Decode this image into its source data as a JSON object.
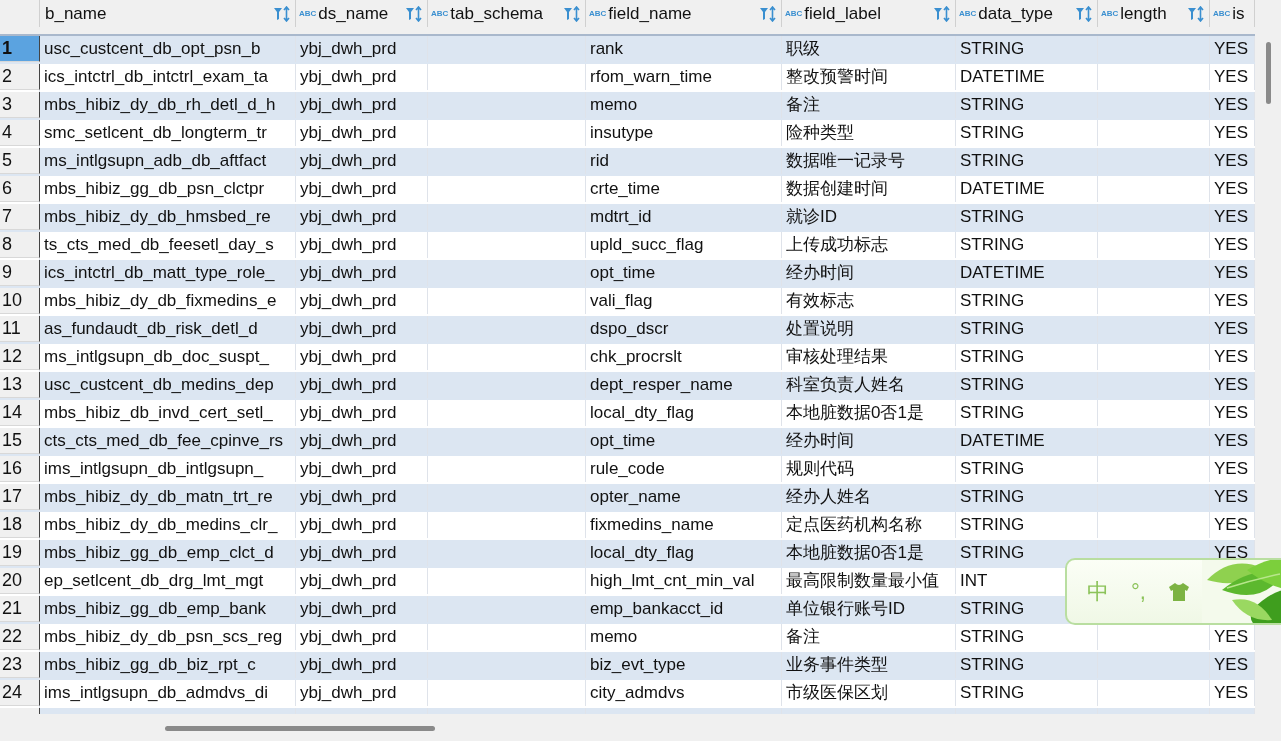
{
  "table": {
    "columns": [
      {
        "label": "b_name",
        "kind": "plain",
        "filter": true
      },
      {
        "label": "ds_name",
        "kind": "string",
        "type_badge": "ABC",
        "filter": true
      },
      {
        "label": "tab_schema",
        "kind": "string",
        "type_badge": "ABC",
        "filter": true
      },
      {
        "label": "field_name",
        "kind": "string",
        "type_badge": "ABC",
        "filter": true
      },
      {
        "label": "field_label",
        "kind": "string",
        "type_badge": "ABC",
        "filter": true
      },
      {
        "label": "data_type",
        "kind": "string",
        "type_badge": "ABC",
        "filter": true
      },
      {
        "label": "length",
        "kind": "string",
        "type_badge": "ABC",
        "filter": true
      },
      {
        "label": "is",
        "kind": "string",
        "type_badge": "ABC",
        "filter": false
      }
    ],
    "rows": [
      {
        "number": "1",
        "selected": true,
        "cells": [
          "usc_custcent_db_opt_psn_b",
          "ybj_dwh_prd",
          "",
          "rank",
          "职级",
          "STRING",
          "",
          "YES"
        ]
      },
      {
        "number": "2",
        "selected": false,
        "cells": [
          "ics_intctrl_db_intctrl_exam_ta",
          "ybj_dwh_prd",
          "",
          "rfom_warn_time",
          "整改预警时间",
          "DATETIME",
          "",
          "YES"
        ]
      },
      {
        "number": "3",
        "selected": false,
        "cells": [
          "mbs_hibiz_dy_db_rh_detl_d_h",
          "ybj_dwh_prd",
          "",
          "memo",
          "备注",
          "STRING",
          "",
          "YES"
        ]
      },
      {
        "number": "4",
        "selected": false,
        "cells": [
          "smc_setlcent_db_longterm_tr",
          "ybj_dwh_prd",
          "",
          "insutype",
          "险种类型",
          "STRING",
          "",
          "YES"
        ]
      },
      {
        "number": "5",
        "selected": false,
        "cells": [
          "ms_intlgsupn_adb_db_aftfact",
          "ybj_dwh_prd",
          "",
          "rid",
          "数据唯一记录号",
          "STRING",
          "",
          "YES"
        ]
      },
      {
        "number": "6",
        "selected": false,
        "cells": [
          "mbs_hibiz_gg_db_psn_clctpr",
          "ybj_dwh_prd",
          "",
          "crte_time",
          "数据创建时间",
          "DATETIME",
          "",
          "YES"
        ]
      },
      {
        "number": "7",
        "selected": false,
        "cells": [
          "mbs_hibiz_dy_db_hmsbed_re",
          "ybj_dwh_prd",
          "",
          "mdtrt_id",
          "就诊ID",
          "STRING",
          "",
          "YES"
        ]
      },
      {
        "number": "8",
        "selected": false,
        "cells": [
          "ts_cts_med_db_feesetl_day_s",
          "ybj_dwh_prd",
          "",
          "upld_succ_flag",
          "上传成功标志",
          "STRING",
          "",
          "YES"
        ]
      },
      {
        "number": "9",
        "selected": false,
        "cells": [
          "ics_intctrl_db_matt_type_role_",
          "ybj_dwh_prd",
          "",
          "opt_time",
          "经办时间",
          "DATETIME",
          "",
          "YES"
        ]
      },
      {
        "number": "10",
        "selected": false,
        "cells": [
          "mbs_hibiz_dy_db_fixmedins_e",
          "ybj_dwh_prd",
          "",
          "vali_flag",
          "有效标志",
          "STRING",
          "",
          "YES"
        ]
      },
      {
        "number": "11",
        "selected": false,
        "cells": [
          "as_fundaudt_db_risk_detl_d",
          "ybj_dwh_prd",
          "",
          "dspo_dscr",
          "处置说明",
          "STRING",
          "",
          "YES"
        ]
      },
      {
        "number": "12",
        "selected": false,
        "cells": [
          "ms_intlgsupn_db_doc_suspt_",
          "ybj_dwh_prd",
          "",
          "chk_procrslt",
          "审核处理结果",
          "STRING",
          "",
          "YES"
        ]
      },
      {
        "number": "13",
        "selected": false,
        "cells": [
          "usc_custcent_db_medins_dep",
          "ybj_dwh_prd",
          "",
          "dept_resper_name",
          "科室负责人姓名",
          "STRING",
          "",
          "YES"
        ]
      },
      {
        "number": "14",
        "selected": false,
        "cells": [
          "mbs_hibiz_db_invd_cert_setl_",
          "ybj_dwh_prd",
          "",
          "local_dty_flag",
          "本地脏数据0否1是",
          "STRING",
          "",
          "YES"
        ]
      },
      {
        "number": "15",
        "selected": false,
        "cells": [
          "cts_cts_med_db_fee_cpinve_rs",
          "ybj_dwh_prd",
          "",
          "opt_time",
          "经办时间",
          "DATETIME",
          "",
          "YES"
        ]
      },
      {
        "number": "16",
        "selected": false,
        "cells": [
          "ims_intlgsupn_db_intlgsupn_",
          "ybj_dwh_prd",
          "",
          "rule_code",
          "规则代码",
          "STRING",
          "",
          "YES"
        ]
      },
      {
        "number": "17",
        "selected": false,
        "cells": [
          "mbs_hibiz_dy_db_matn_trt_re",
          "ybj_dwh_prd",
          "",
          "opter_name",
          "经办人姓名",
          "STRING",
          "",
          "YES"
        ]
      },
      {
        "number": "18",
        "selected": false,
        "cells": [
          "mbs_hibiz_dy_db_medins_clr_",
          "ybj_dwh_prd",
          "",
          "fixmedins_name",
          "定点医药机构名称",
          "STRING",
          "",
          "YES"
        ]
      },
      {
        "number": "19",
        "selected": false,
        "cells": [
          "mbs_hibiz_gg_db_emp_clct_d",
          "ybj_dwh_prd",
          "",
          "local_dty_flag",
          "本地脏数据0否1是",
          "STRING",
          "",
          "YES"
        ]
      },
      {
        "number": "20",
        "selected": false,
        "cells": [
          "ep_setlcent_db_drg_lmt_mgt",
          "ybj_dwh_prd",
          "",
          "high_lmt_cnt_min_val",
          "最高限制数量最小值",
          "INT",
          "",
          ""
        ]
      },
      {
        "number": "21",
        "selected": false,
        "cells": [
          "mbs_hibiz_gg_db_emp_bank",
          "ybj_dwh_prd",
          "",
          "emp_bankacct_id",
          "单位银行账号ID",
          "STRING",
          "",
          ""
        ]
      },
      {
        "number": "22",
        "selected": false,
        "cells": [
          "mbs_hibiz_dy_db_psn_scs_reg",
          "ybj_dwh_prd",
          "",
          "memo",
          "备注",
          "STRING",
          "",
          "YES"
        ]
      },
      {
        "number": "23",
        "selected": false,
        "cells": [
          "mbs_hibiz_gg_db_biz_rpt_c",
          "ybj_dwh_prd",
          "",
          "biz_evt_type",
          "业务事件类型",
          "STRING",
          "",
          "YES"
        ]
      },
      {
        "number": "24",
        "selected": false,
        "cells": [
          "ims_intlgsupn_db_admdvs_di",
          "ybj_dwh_prd",
          "",
          "city_admdvs",
          "市级医保区划",
          "STRING",
          "",
          "YES"
        ]
      }
    ]
  },
  "ime_toolbar": {
    "mode": "中",
    "punctuation": "°,"
  }
}
